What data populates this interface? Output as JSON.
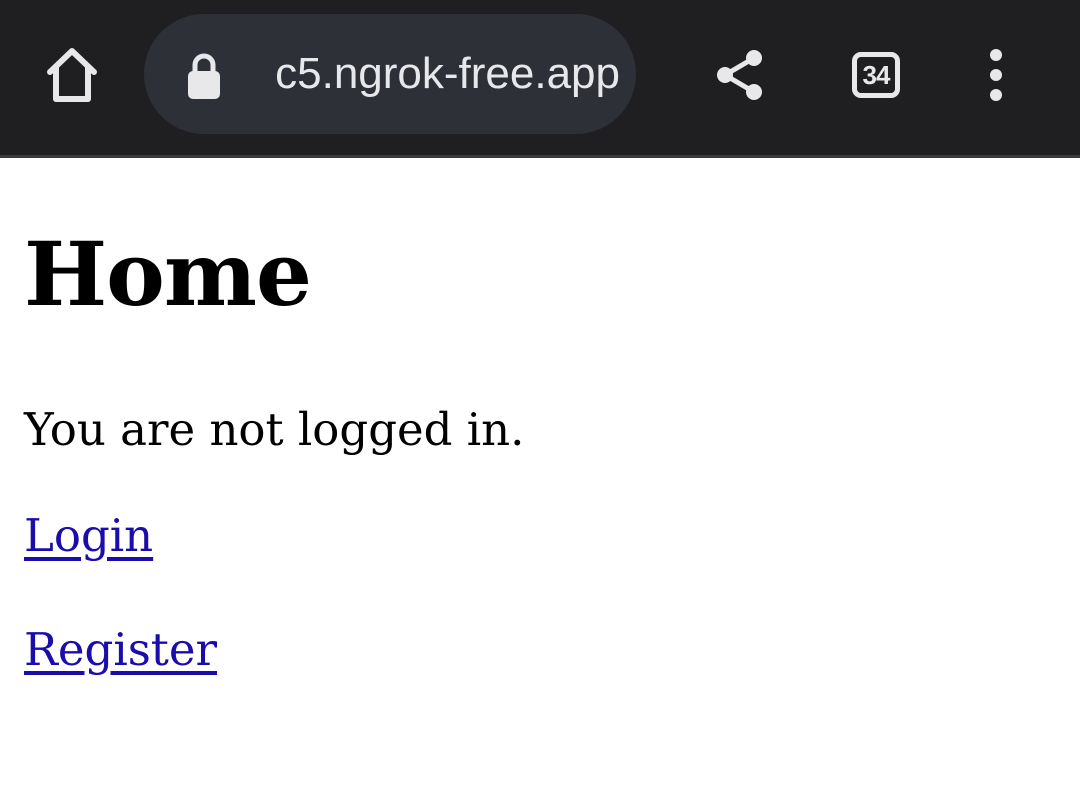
{
  "browser": {
    "url_display": "c5.ngrok-free.app",
    "tab_count": "34",
    "icons": {
      "home": "home-icon",
      "lock": "lock-icon",
      "share": "share-icon",
      "tabs": "tab-switcher-icon",
      "menu": "more-vert-icon"
    },
    "colors": {
      "toolbar_bg": "#1f1f22",
      "url_bar_bg": "#2e3038",
      "icon_color": "#e8e8ea"
    }
  },
  "page": {
    "heading": "Home",
    "status_text": "You are not logged in.",
    "links": {
      "login": "Login",
      "register": "Register"
    },
    "colors": {
      "link": "#1a0dab",
      "text": "#000000",
      "background": "#ffffff"
    }
  }
}
